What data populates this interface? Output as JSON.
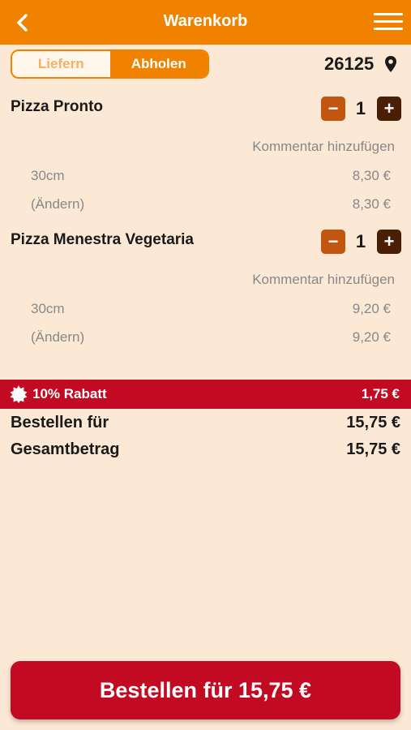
{
  "header": {
    "title": "Warenkorb",
    "back_icon": "chevron-left-icon",
    "menu_icon": "hamburger-menu-icon"
  },
  "mode_toggle": {
    "options": [
      "Liefern",
      "Abholen"
    ],
    "selected": "Abholen"
  },
  "location": {
    "zip": "26125",
    "icon": "location-pin-icon"
  },
  "cart": {
    "items": [
      {
        "name": "Pizza Pronto",
        "quantity": "1",
        "comment_link": "Kommentar hinzufügen",
        "options": [
          {
            "label": "30cm",
            "price": "8,30 €"
          },
          {
            "label": "(Ändern)",
            "price": "8,30 €"
          }
        ]
      },
      {
        "name": "Pizza Menestra Vegetaria",
        "quantity": "1",
        "comment_link": "Kommentar hinzufügen",
        "options": [
          {
            "label": "30cm",
            "price": "9,20 €"
          },
          {
            "label": "(Ändern)",
            "price": "9,20 €"
          }
        ]
      }
    ]
  },
  "discount": {
    "label": "10% Rabatt",
    "value": "1,75 €"
  },
  "summary": {
    "order_for_label": "Bestellen für",
    "order_for_value": "15,75 €",
    "total_label": "Gesamtbetrag",
    "total_value": "15,75 €"
  },
  "order_button": {
    "label": "Bestellen für 15,75 €"
  },
  "colors": {
    "accent": "#f08200",
    "danger": "#c20a22",
    "background": "#fbe9d5"
  }
}
